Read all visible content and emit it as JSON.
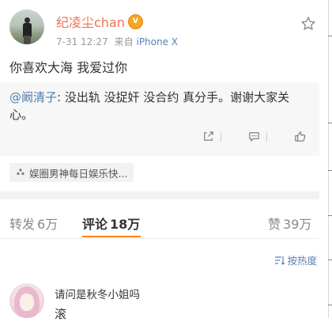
{
  "post": {
    "author": "纪凌尘chan",
    "vip_badge": "V",
    "date": "7-31 12:27",
    "source_prefix": "来自",
    "source_device": "iPhone X",
    "text": "你喜欢大海 我爱过你"
  },
  "repost": {
    "mention": "@阚清子",
    "text": ": 没出轨 没捉奸 没合约 真分手。谢谢大家关心。"
  },
  "topic": {
    "label": "娱圈男神每日娱乐快..."
  },
  "tabs": {
    "repost_label": "转发",
    "repost_count": "6万",
    "comment_label": "评论",
    "comment_count": "18万",
    "like_label": "赞",
    "like_count": "39万"
  },
  "sort": {
    "label": "按热度"
  },
  "comment": {
    "user": "请问是秋冬小姐吗",
    "text": "滚"
  },
  "colors": {
    "accent": "#ff8200",
    "username": "#eb7350",
    "link": "#507daf"
  }
}
